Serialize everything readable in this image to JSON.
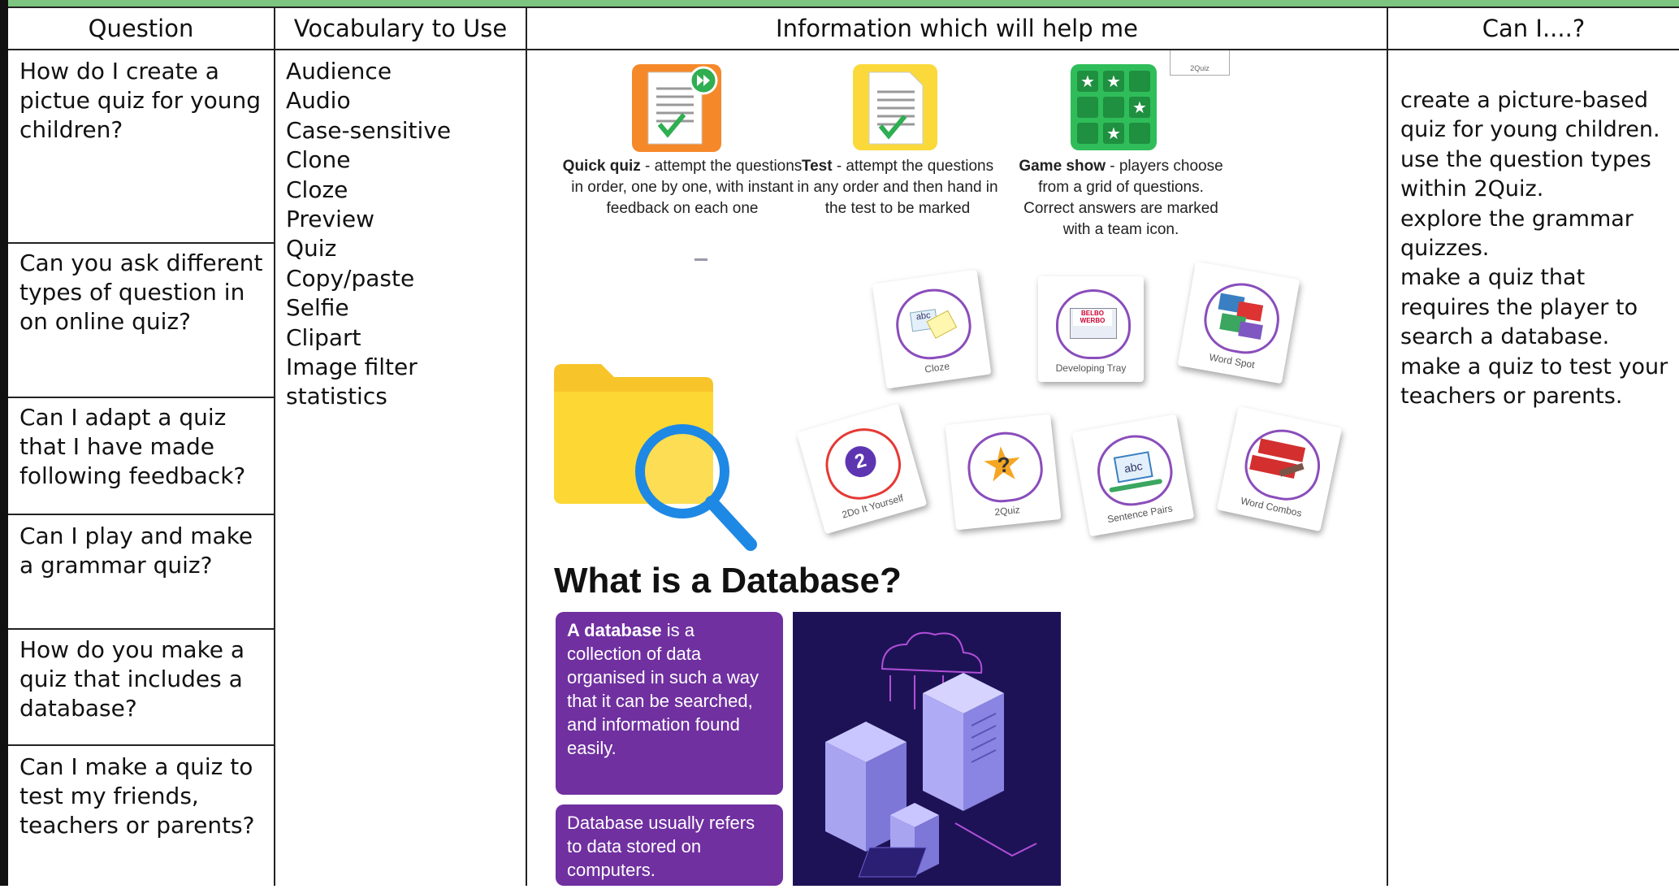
{
  "headers": {
    "question": "Question",
    "vocabulary": "Vocabulary to Use",
    "information": "Information which will help me",
    "can_i": "Can I....?"
  },
  "questions": [
    "How do I create a pictue quiz for young children?",
    "Can you ask different types of question in on online quiz?",
    "Can I adapt a quiz that I have made following feedback?",
    "Can I play and make a grammar quiz?",
    "How do you make a quiz that includes a database?",
    "Can I make a quiz to test my friends, teachers or parents?"
  ],
  "vocabulary": [
    "Audience",
    "Audio",
    "Case-sensitive",
    "Clone",
    "Cloze",
    "Preview",
    "Quiz",
    "Copy/paste",
    "Selfie",
    "Clipart",
    "Image filter",
    "statistics"
  ],
  "can_i": [
    "create a picture-based quiz for young children.",
    "use the question types within 2Quiz.",
    "explore the grammar quizzes.",
    "make a quiz that requires the player to search a database.",
    "make a quiz to test your teachers or parents."
  ],
  "quiz_types": [
    {
      "name": "Quick quiz",
      "desc": " - attempt the questions in order, one by one, with instant feedback on each one"
    },
    {
      "name": "Test",
      "desc": " - attempt the questions in any order and then hand in the test to be marked"
    },
    {
      "name": "Game show",
      "desc": " - players choose from a grid of questions. Correct answers are marked with a team icon."
    }
  ],
  "small_label": "2Quiz",
  "apps_row1": [
    "Cloze",
    "Developing Tray",
    "Word Spot"
  ],
  "apps_row2": [
    "2Do It Yourself",
    "2Quiz",
    "Sentence Pairs",
    "Word Combos"
  ],
  "developing_tray_icon_text": "BELBO WERBO",
  "database": {
    "title": "What is a Database?",
    "def_bold": "A database",
    "def_rest": " is a collection of data organised in such a way that it can be searched, and information found easily.",
    "note": "Database usually refers to data stored on computers."
  },
  "colors": {
    "header_bar": "#7cc47f",
    "purple": "#7030a0",
    "dark_panel": "#1e1257",
    "folder": "#fdd835",
    "magnifier": "#1e88e5"
  }
}
